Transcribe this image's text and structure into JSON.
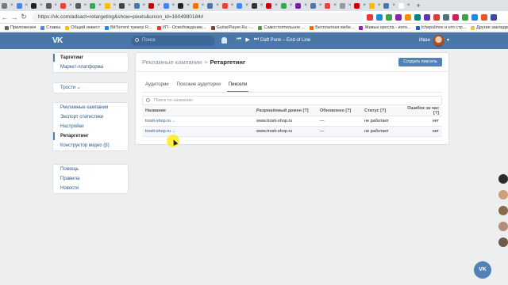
{
  "browser": {
    "url": "https://vk.com/adsact=retargeting&show=pixels&union_id=1604980184#",
    "bookmarks": [
      "Приложения",
      "Ставка",
      "Общий инвест",
      "BitTorrent трекер R...",
      "УП - Освобождение...",
      "GuitarPlayer.Ru -...",
      "Самостоятельное ...",
      "Бесплатная мебе...",
      "Живые кресла - инте...",
      "Ichepulinov и его стр...",
      "Другие закладки"
    ],
    "tab_colors": [
      "#7a7a7a",
      "#4285f4",
      "#1f1f1f",
      "#5b5b5b",
      "#ea4335",
      "#5b5b5b",
      "#34a853",
      "#fbbc05",
      "#444",
      "#4a76a8",
      "#cc0000",
      "#4285f4",
      "#222",
      "#ff6f00",
      "#4a76a8",
      "#ea4335",
      "#4285f4",
      "#333",
      "#cc0000",
      "#34a853",
      "#7b1fa2",
      "#4a76a8",
      "#ea4335",
      "#999",
      "#cc0000",
      "#fbbc05",
      "#4a76a8",
      "#fff"
    ],
    "ext_colors": [
      "#e53935",
      "#1e88e5",
      "#43a047",
      "#8e24aa",
      "#fb8c00",
      "#00897b",
      "#5e35b1",
      "#e53935",
      "#546e7a",
      "#d81b60",
      "#43a047",
      "#1e88e5",
      "#f4511e",
      "#3949ab"
    ]
  },
  "header": {
    "logo": "VK",
    "search_placeholder": "Поиск",
    "track": "Daft Punk – End of Line",
    "user_name": "Иван"
  },
  "sidebar": {
    "group1": [
      "Таргетинг",
      "Маркет-платформа"
    ],
    "group2": [
      "Трости"
    ],
    "group3": [
      "Рекламные кампании",
      "Экспорт статистики",
      "Настройки",
      "Ретаргетинг",
      "Конструктор видео (β)"
    ],
    "group4": [
      "Помощь",
      "Правила",
      "Новости"
    ]
  },
  "main": {
    "breadcrumb_parent": "Рекламные кампании",
    "breadcrumb_sep": ">",
    "breadcrumb_current": "Ретаргетинг",
    "create_button": "Создать пиксель",
    "tabs": [
      "Аудитории",
      "Похожие аудитории",
      "Пиксели"
    ],
    "filter_placeholder": "Поиск по названию",
    "columns": [
      "Название",
      "Разрешённый домен [?]",
      "Обновлено [?]",
      "Статус [?]",
      "Ошибок за час [?]"
    ],
    "rows": [
      {
        "name": "trosti-shop.ru",
        "domain": "www.trosti-shop.ru",
        "updated": "—",
        "status": "не работает",
        "errors": "нет"
      },
      {
        "name": "trosti-shop.ru",
        "domain": "www.trosti-shop.ru",
        "updated": "—",
        "status": "не работает",
        "errors": "нет"
      }
    ]
  },
  "chat": {
    "label": "VK"
  }
}
